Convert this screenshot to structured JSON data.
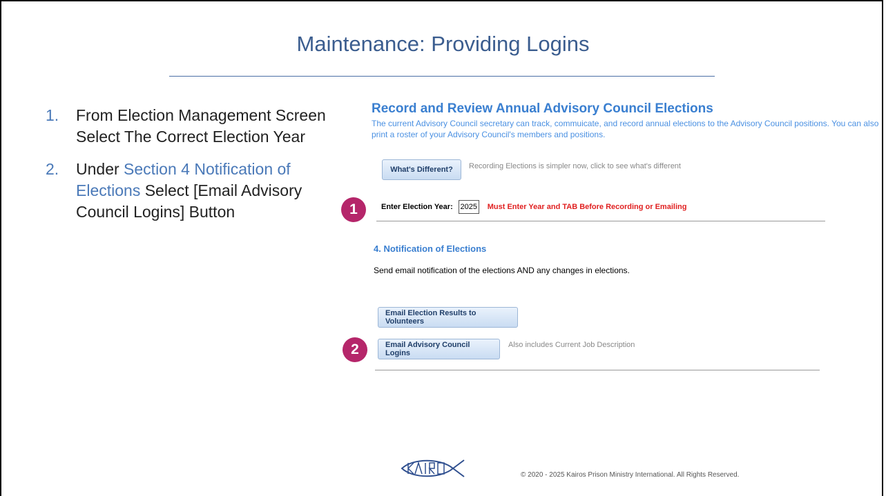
{
  "slide": {
    "title": "Maintenance: Providing Logins",
    "steps": [
      {
        "num": "1.",
        "text": "From Election Management Screen Select The Correct Election Year"
      },
      {
        "num": "2.",
        "pre": "Under ",
        "highlight": "Section 4 Notification of Elections",
        "post": " Select [Email Advisory Council Logins] Button"
      }
    ],
    "badges": [
      "1",
      "2"
    ],
    "copyright": "© 2020 - 2025 Kairos Prison Ministry International. All Rights Reserved.",
    "logo_text": "KAIROS"
  },
  "screenshot": {
    "heading": "Record and Review Annual Advisory Council Elections",
    "description": "The current Advisory Council secretary can track, commuicate, and record annual elections to the Advisory Council positions. You can also print a roster of your Advisory Council's members and positions.",
    "whats_different_button": "What's Different?",
    "whats_different_note": "Recording Elections is simpler now, click to see what's different",
    "year_label": "Enter Election Year:",
    "year_value": "2025",
    "year_warning": "Must Enter Year and TAB Before Recording or Emailing",
    "section_heading": "4. Notification of Elections",
    "section_text": "Send email notification of the elections AND any changes in elections.",
    "email_results_button": "Email Election Results to Volunteers",
    "email_logins_button": "Email Advisory Council Logins",
    "email_logins_note": "Also includes Current Job Description"
  },
  "colors": {
    "title": "#3b5d8f",
    "accent": "#4a79b8",
    "badge": "#b5266a",
    "heading_blue": "#3a7fd0",
    "warning_red": "#e02020"
  }
}
